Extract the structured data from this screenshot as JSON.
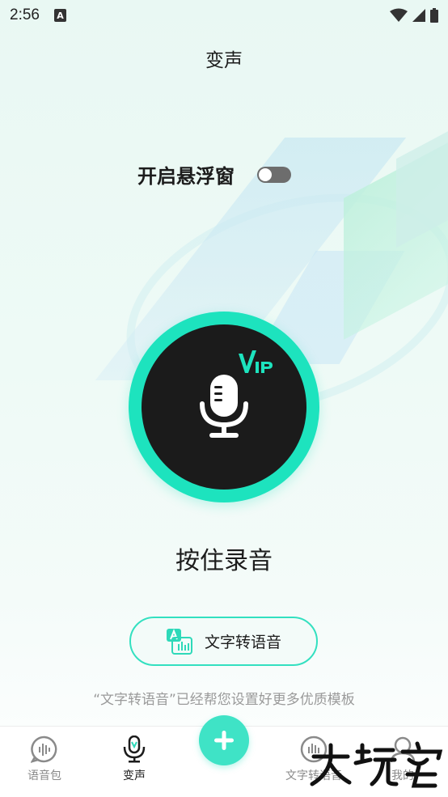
{
  "status_bar": {
    "time": "2:56",
    "notification_badge": "A"
  },
  "header": {
    "title": "变声"
  },
  "float_window": {
    "label": "开启悬浮窗",
    "enabled": false
  },
  "record": {
    "label": "按住录音",
    "badge": "VIP",
    "accent_color": "#1de3be"
  },
  "tts_button": {
    "label": "文字转语音"
  },
  "tts_hint": "“文字转语音”已经帮您设置好更多优质模板",
  "bottom_nav": {
    "items": [
      {
        "label": "语音包",
        "icon": "chat-audio-icon",
        "active": false
      },
      {
        "label": "变声",
        "icon": "microphone-icon",
        "active": true
      },
      {
        "label": "文字转语音",
        "icon": "audio-wave-icon",
        "active": false
      },
      {
        "label": "我的",
        "icon": "user-icon",
        "active": false
      }
    ],
    "add_icon": "plus-icon"
  },
  "watermark": {
    "text": "大玩客"
  }
}
